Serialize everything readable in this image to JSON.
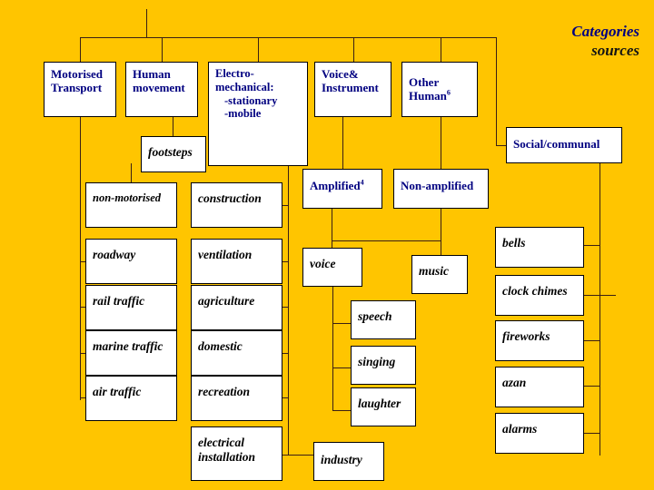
{
  "title": {
    "line1": "Categories",
    "line2": "sources"
  },
  "colors": {
    "background": "#FFC500",
    "box_fill": "#FFFFFF",
    "box_border": "#000000",
    "category_text": "#000080",
    "leaf_text": "#000000",
    "connector": "#3B1F14"
  },
  "categories": [
    {
      "id": "motorised-transport",
      "label": "Motorised Transport"
    },
    {
      "id": "human-movement",
      "label": "Human movement"
    },
    {
      "id": "electro-mechanical",
      "label": "Electro-mechanical:",
      "sub1": "-stationary",
      "sub2": "-mobile"
    },
    {
      "id": "voice-instrument",
      "label": "Voice& Instrument"
    },
    {
      "id": "other-human",
      "label": "Other Human",
      "superscript": "6"
    },
    {
      "id": "social-communal",
      "label": "Social/communal"
    }
  ],
  "subcategories": [
    {
      "id": "amplified",
      "label": "Amplified",
      "superscript": "4"
    },
    {
      "id": "non-amplified",
      "label": "Non-amplified"
    }
  ],
  "leaves": {
    "human_movement": [
      {
        "id": "footsteps",
        "label": "footsteps"
      }
    ],
    "motorised_transport": [
      {
        "id": "non-motorised",
        "label": "non-motorised"
      },
      {
        "id": "roadway",
        "label": "roadway"
      },
      {
        "id": "rail-traffic",
        "label": "rail traffic"
      },
      {
        "id": "marine-traffic",
        "label": "marine traffic"
      },
      {
        "id": "air-traffic",
        "label": "air traffic"
      }
    ],
    "electro_mechanical": [
      {
        "id": "construction",
        "label": "construction"
      },
      {
        "id": "ventilation",
        "label": "ventilation"
      },
      {
        "id": "agriculture",
        "label": "agriculture"
      },
      {
        "id": "domestic",
        "label": "domestic"
      },
      {
        "id": "recreation",
        "label": "recreation"
      },
      {
        "id": "electrical-installation",
        "label": "electrical",
        "label2": "installation"
      },
      {
        "id": "industry",
        "label": "industry"
      }
    ],
    "voice_instrument": [
      {
        "id": "voice",
        "label": "voice"
      },
      {
        "id": "music",
        "label": "music"
      },
      {
        "id": "speech",
        "label": "speech"
      },
      {
        "id": "singing",
        "label": "singing"
      },
      {
        "id": "laughter",
        "label": "laughter"
      }
    ],
    "social_communal": [
      {
        "id": "bells",
        "label": "bells"
      },
      {
        "id": "clock-chimes",
        "label": "clock chimes"
      },
      {
        "id": "fireworks",
        "label": "fireworks"
      },
      {
        "id": "azan",
        "label": "azan"
      },
      {
        "id": "alarms",
        "label": "alarms"
      }
    ]
  }
}
